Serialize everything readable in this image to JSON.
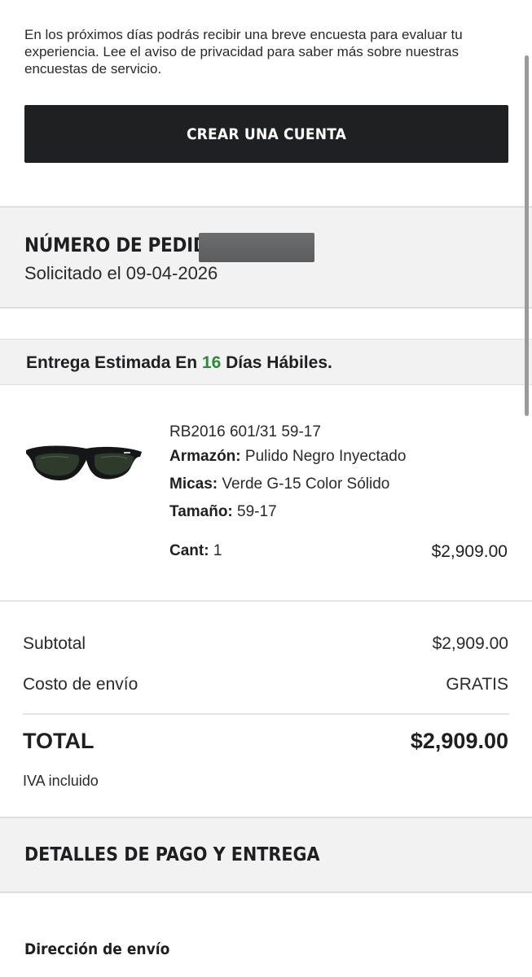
{
  "survey_notice": "En los próximos días podrás recibir una breve encuesta para evaluar tu experiencia. Lee el aviso de privacidad para saber más sobre nuestras encuestas de servicio.",
  "create_account_button": "CREAR UNA CUENTA",
  "order": {
    "number_label": "NÚMERO DE PEDIDO:",
    "requested_date": "Solicitado el 09-04-2026"
  },
  "delivery": {
    "prefix": "Entrega Estimada En",
    "days": "16",
    "suffix": "Días Hábiles."
  },
  "product": {
    "image_icon": "sunglasses-image",
    "model": "RB2016 601/31 59-17",
    "frame_label": "Armazón:",
    "frame_value": "Pulido Negro Inyectado",
    "lenses_label": "Micas:",
    "lenses_value": "Verde G-15 Color Sólido",
    "size_label": "Tamaño:",
    "size_value": "59-17",
    "qty_label": "Cant:",
    "qty_value": "1",
    "price": "$2,909.00"
  },
  "summary": {
    "subtotal_label": "Subtotal",
    "subtotal_value": "$2,909.00",
    "shipping_label": "Costo de envío",
    "shipping_value": "GRATIS",
    "total_label": "TOTAL",
    "total_value": "$2,909.00",
    "tax_note": "IVA incluido"
  },
  "payment_details_title": "DETALLES DE PAGO Y ENTREGA",
  "shipping_address_title": "Dirección de envío",
  "colors": {
    "accent_green": "#2b8a3e",
    "button_bg": "#1f2022",
    "section_bg": "#f2f2f3"
  }
}
